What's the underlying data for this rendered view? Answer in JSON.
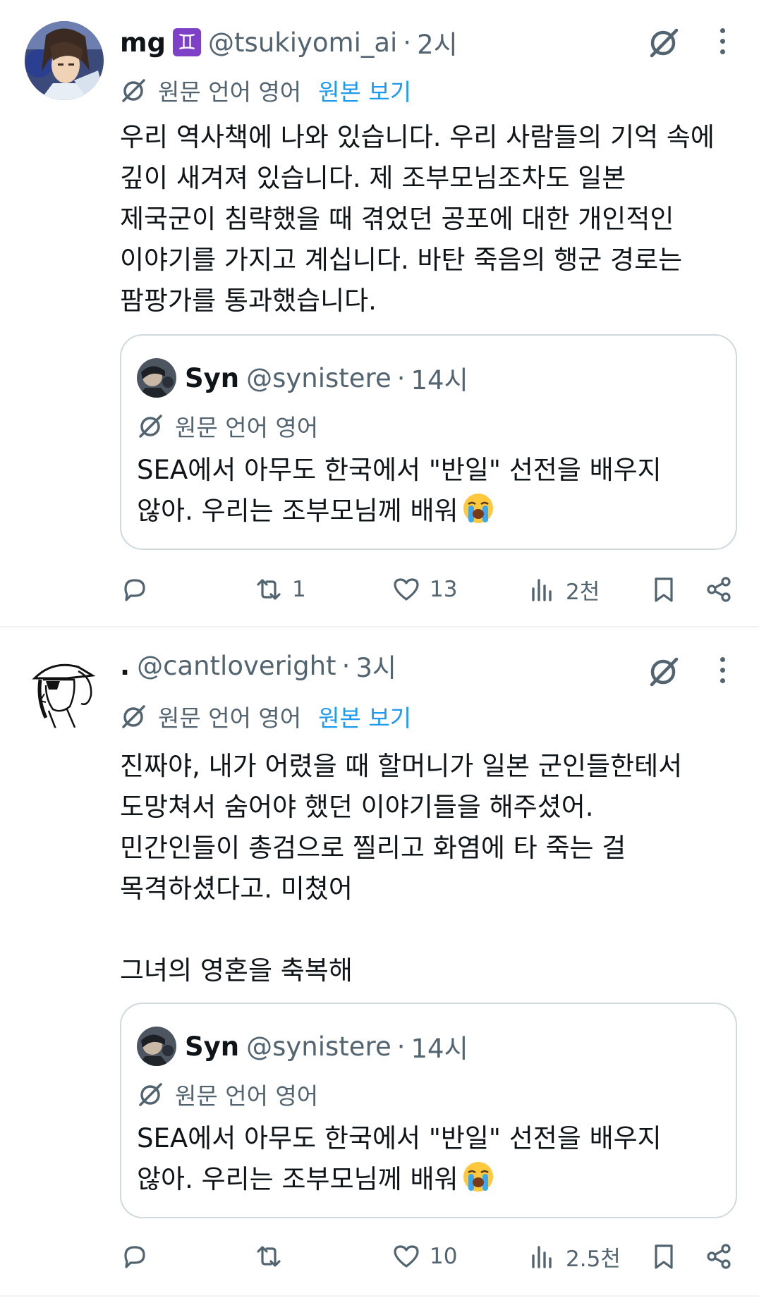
{
  "tweets": [
    {
      "name": "mg",
      "badge": "♊",
      "handle": "@tsukiyomi_ai",
      "separator": "·",
      "time": "2시",
      "translation": {
        "label": "원문 언어 영어",
        "show_original": "원본 보기"
      },
      "text": "우리 역사책에 나와 있습니다. 우리 사람들의 기억 속에\n깊이 새겨져 있습니다. 제 조부모님조차도 일본\n제국군이 침략했을 때 겪었던 공포에 대한 개인적인\n이야기를 가지고 계십니다. 바탄 죽음의 행군 경로는\n팜팡가를 통과했습니다.",
      "quote": {
        "name": "Syn",
        "handle": "@synistere",
        "separator": "·",
        "time": "14시",
        "translation_label": "원문 언어 영어",
        "text": "SEA에서 아무도 한국에서 \"반일\" 선전을 배우지\n않아. 우리는 조부모님께 배워"
      },
      "actions": {
        "replies": "",
        "retweets": "1",
        "likes": "13",
        "views": "2천"
      }
    },
    {
      "name": ".",
      "handle": "@cantloveright",
      "separator": "·",
      "time": "3시",
      "translation": {
        "label": "원문 언어 영어",
        "show_original": "원본 보기"
      },
      "text": "진짜야, 내가 어렸을 때 할머니가 일본 군인들한테서\n도망쳐서 숨어야 했던 이야기들을 해주셨어.\n민간인들이 총검으로 찔리고 화염에 타 죽는 걸\n목격하셨다고. 미쳤어\n\n그녀의 영혼을 축복해",
      "quote": {
        "name": "Syn",
        "handle": "@synistere",
        "separator": "·",
        "time": "14시",
        "translation_label": "원문 언어 영어",
        "text": "SEA에서 아무도 한국에서 \"반일\" 선전을 배우지\n않아. 우리는 조부모님께 배워"
      },
      "actions": {
        "replies": "",
        "retweets": "",
        "likes": "10",
        "views": "2.5천"
      }
    }
  ],
  "icons": {
    "reply": "reply-icon",
    "retweet": "retweet-icon",
    "like": "heart-icon",
    "views": "views-icon",
    "bookmark": "bookmark-icon",
    "share": "share-icon",
    "grok": "grok-icon",
    "more": "more-icon",
    "translate": "translate-icon",
    "emoji": "loudly-crying-face-emoji"
  },
  "colors": {
    "text": "#0f1419",
    "secondary": "#536471",
    "link": "#1d9bf0",
    "border": "#cfd9de",
    "badge": "#7e40c6"
  }
}
